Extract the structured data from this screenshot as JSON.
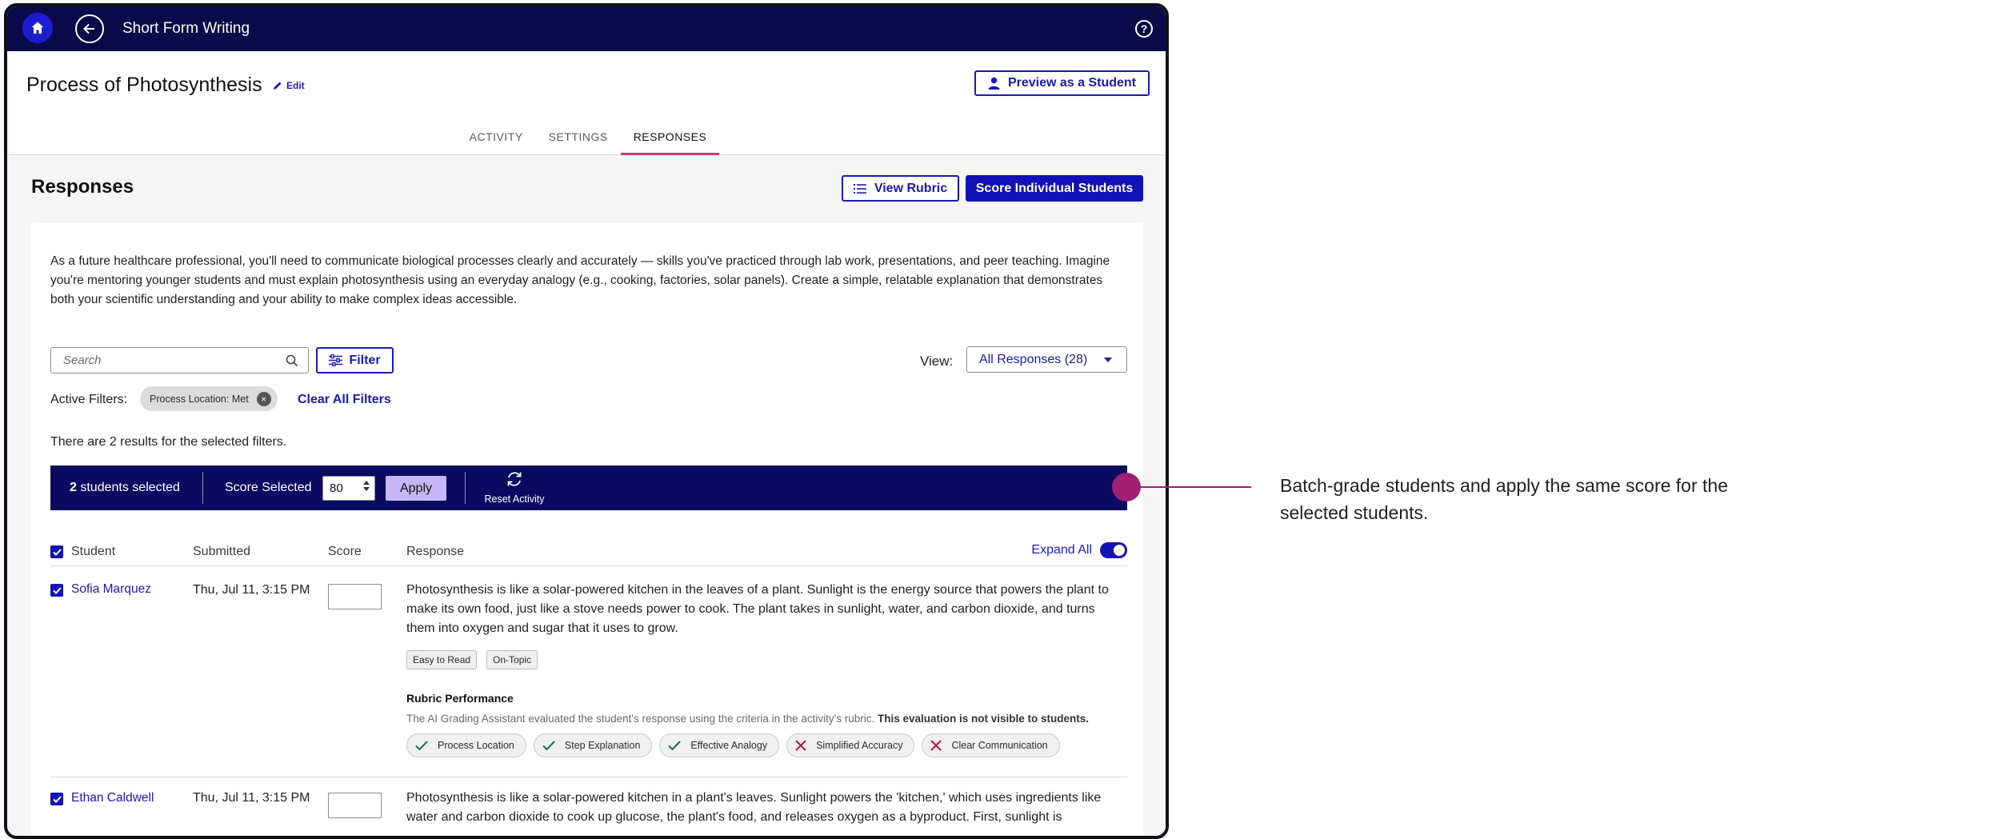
{
  "app": {
    "title": "Short Form Writing"
  },
  "header": {
    "page_title": "Process of Photosynthesis",
    "edit_label": "Edit",
    "preview_label": "Preview as a Student",
    "tabs": [
      {
        "label": "ACTIVITY",
        "active": false
      },
      {
        "label": "SETTINGS",
        "active": false
      },
      {
        "label": "RESPONSES",
        "active": true
      }
    ]
  },
  "responses": {
    "title": "Responses",
    "view_rubric_label": "View Rubric",
    "score_individual_label": "Score Individual Students",
    "prompt": "As a future healthcare professional, you'll need to communicate biological processes clearly and accurately — skills you've practiced through lab work, presentations, and peer teaching. Imagine you're mentoring younger students and must explain photosynthesis using an everyday analogy (e.g., cooking, factories, solar panels). Create a simple, relatable explanation that demonstrates both your scientific understanding and your ability to make complex ideas accessible.",
    "search_placeholder": "Search",
    "filter_label": "Filter",
    "view_label": "View:",
    "view_value": "All Responses (28)",
    "active_filters_label": "Active Filters:",
    "active_filter_chip": "Process Location: Met",
    "clear_filters_label": "Clear All Filters",
    "results_text": "There are 2 results for the selected filters."
  },
  "batch_bar": {
    "selected_count": "2",
    "selected_suffix": "students selected",
    "score_selected_label": "Score Selected",
    "score_value": "80",
    "apply_label": "Apply",
    "reset_label": "Reset Activity"
  },
  "table": {
    "columns": {
      "student": "Student",
      "submitted": "Submitted",
      "score": "Score",
      "response": "Response"
    },
    "expand_all_label": "Expand All",
    "expand_all_on": true,
    "rows": [
      {
        "name": "Sofia Marquez",
        "submitted": "Thu, Jul 11, 3:15 PM",
        "response": "Photosynthesis is like a solar-powered kitchen in the leaves of a plant. Sunlight is the energy source that powers the plant to make its own food, just like a stove needs power to cook. The plant takes in sunlight, water, and carbon dioxide, and turns them into oxygen and sugar that it uses to grow.",
        "tags": [
          "Easy to Read",
          "On-Topic"
        ],
        "rubric_title": "Rubric Performance",
        "rubric_note": "The AI Grading Assistant evaluated the student's response using the criteria in the activity's rubric.",
        "rubric_note_bold": "This evaluation is not visible to students.",
        "criteria": [
          {
            "label": "Process Location",
            "status": "met"
          },
          {
            "label": "Step Explanation",
            "status": "met"
          },
          {
            "label": "Effective Analogy",
            "status": "met"
          },
          {
            "label": "Simplified Accuracy",
            "status": "not-met"
          },
          {
            "label": "Clear Communication",
            "status": "not-met"
          }
        ]
      },
      {
        "name": "Ethan Caldwell",
        "submitted": "Thu, Jul 11, 3:15 PM",
        "response": "Photosynthesis is like a solar-powered kitchen in a plant's leaves. Sunlight powers the 'kitchen,' which uses ingredients like water and carbon dioxide to cook up glucose, the plant's food, and releases oxygen as a byproduct. First, sunlight is"
      }
    ]
  },
  "annotation": {
    "text": "Batch-grade students and apply the same score for the selected students."
  },
  "colors": {
    "nav_bg": "#0a0a4a",
    "accent_blue": "#1a1ab8",
    "tab_underline": "#d6337a",
    "apply_bg": "#c7b6f5",
    "callout": "#a11f73",
    "met_check": "#1b6e3c",
    "not_met_x": "#c0143c"
  }
}
